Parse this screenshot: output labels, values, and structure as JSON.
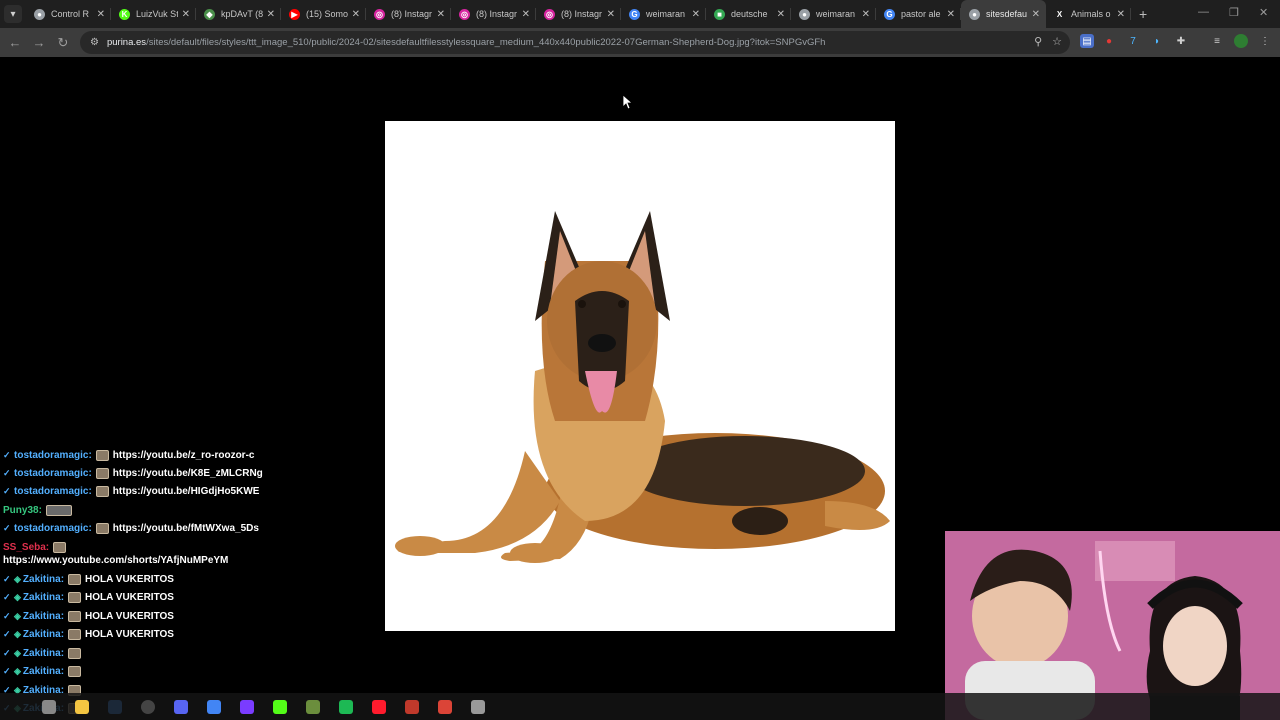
{
  "tabs": [
    {
      "title": "Control R",
      "fav_color": "#9aa0a6",
      "fav_glyph": "●",
      "icon": "globe-icon"
    },
    {
      "title": "LuizVuk Stu",
      "fav_color": "#53fc18",
      "fav_glyph": "K",
      "icon": "kick-icon"
    },
    {
      "title": "kpDAvT (8",
      "fav_color": "#4a8f4a",
      "fav_glyph": "◆",
      "icon": "page-icon"
    },
    {
      "title": "(15) Somo",
      "fav_color": "#ff0000",
      "fav_glyph": "▶",
      "icon": "youtube-icon"
    },
    {
      "title": "(8) Instagr",
      "fav_color": "#d6249f",
      "fav_glyph": "◎",
      "icon": "instagram-icon"
    },
    {
      "title": "(8) Instagr",
      "fav_color": "#d6249f",
      "fav_glyph": "◎",
      "icon": "instagram-icon"
    },
    {
      "title": "(8) Instagr",
      "fav_color": "#d6249f",
      "fav_glyph": "◎",
      "icon": "instagram-icon"
    },
    {
      "title": "weimaran",
      "fav_color": "#4285f4",
      "fav_glyph": "G",
      "icon": "google-icon"
    },
    {
      "title": "deutsche",
      "fav_color": "#34a853",
      "fav_glyph": "■",
      "icon": "sheet-icon"
    },
    {
      "title": "weimaran",
      "fav_color": "#9aa0a6",
      "fav_glyph": "●",
      "icon": "globe-icon"
    },
    {
      "title": "pastor ale",
      "fav_color": "#4285f4",
      "fav_glyph": "G",
      "icon": "google-icon"
    },
    {
      "title": "sitesdefau",
      "fav_color": "#9aa0a6",
      "fav_glyph": "●",
      "icon": "globe-icon",
      "active": true
    },
    {
      "title": "Animals o",
      "fav_color": "#1f1f1f",
      "fav_glyph": "X",
      "icon": "x-icon"
    }
  ],
  "toolbar": {
    "url_host": "purina.es",
    "url_path": "/sites/default/files/styles/ttt_image_510/public/2024-02/sitesdefaultfilesstylessquare_medium_440x440public2022-07German-Shepherd-Dog.jpg?itok=SNPGvGFh"
  },
  "chat": [
    {
      "user": "tostadoramagic:",
      "color": "#53b0ff",
      "msg": "https://youtu.be/z_ro-roozor-c",
      "emote": true,
      "badge": "✓"
    },
    {
      "user": "tostadoramagic:",
      "color": "#53b0ff",
      "msg": "https://youtu.be/K8E_zMLCRNg",
      "emote": true,
      "badge": "✓"
    },
    {
      "user": "tostadoramagic:",
      "color": "#53b0ff",
      "msg": "https://youtu.be/HIGdjHo5KWE",
      "emote": true,
      "badge": "✓"
    },
    {
      "user": "Puny38:",
      "color": "#36c77f",
      "msg": "",
      "emote_wide": true
    },
    {
      "user": "tostadoramagic:",
      "color": "#53b0ff",
      "msg": "https://youtu.be/fMtWXwa_5Ds",
      "emote": true,
      "badge": "✓"
    },
    {
      "user": "SS_Seba:",
      "color": "#e0304d",
      "msg": "",
      "emote": true
    },
    {
      "user": "",
      "color": "#ffffff",
      "msg": "https://www.youtube.com/shorts/YAfjNuMPeYM"
    },
    {
      "user": "Zakitina:",
      "color": "#53b0ff",
      "msg": "HOLA VUKERITOS",
      "emote": true,
      "badge": "✓",
      "badge2": "◈"
    },
    {
      "user": "Zakitina:",
      "color": "#53b0ff",
      "msg": "HOLA VUKERITOS",
      "emote": true,
      "badge": "✓",
      "badge2": "◈"
    },
    {
      "user": "Zakitina:",
      "color": "#53b0ff",
      "msg": "HOLA VUKERITOS",
      "emote": true,
      "badge": "✓",
      "badge2": "◈"
    },
    {
      "user": "Zakitina:",
      "color": "#53b0ff",
      "msg": "HOLA VUKERITOS",
      "emote": true,
      "badge": "✓",
      "badge2": "◈"
    },
    {
      "user": "Zakitina:",
      "color": "#53b0ff",
      "msg": "",
      "emote": true,
      "badge": "✓",
      "badge2": "◈"
    },
    {
      "user": "Zakitina:",
      "color": "#53b0ff",
      "msg": "",
      "emote": true,
      "badge": "✓",
      "badge2": "◈"
    },
    {
      "user": "Zakitina:",
      "color": "#53b0ff",
      "msg": "",
      "emote": true,
      "badge": "✓",
      "badge2": "◈"
    },
    {
      "user": "Zakitina:",
      "color": "#53b0ff",
      "msg": "",
      "emote": true,
      "badge": "✓",
      "badge2": "◈"
    }
  ],
  "taskbar": [
    {
      "name": "search-taskbar-icon",
      "color": "#888888"
    },
    {
      "name": "file-explorer-icon",
      "color": "#f4c542"
    },
    {
      "name": "steam-icon",
      "color": "#1b2838"
    },
    {
      "name": "obs-icon",
      "color": "#444444"
    },
    {
      "name": "discord-icon",
      "color": "#5865f2"
    },
    {
      "name": "chrome-icon",
      "color": "#4285f4"
    },
    {
      "name": "app-c-icon",
      "color": "#7a3cff"
    },
    {
      "name": "kick-taskbar-icon",
      "color": "#53fc18"
    },
    {
      "name": "minecraft-icon",
      "color": "#6b8e3d"
    },
    {
      "name": "spotify-icon",
      "color": "#1db954"
    },
    {
      "name": "opera-icon",
      "color": "#ff1b2d"
    },
    {
      "name": "voicemeeter-icon",
      "color": "#c0392b"
    },
    {
      "name": "chrome-alt-icon",
      "color": "#db4437"
    },
    {
      "name": "app-misc-icon",
      "color": "#999999"
    }
  ]
}
